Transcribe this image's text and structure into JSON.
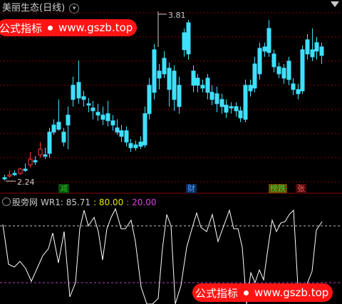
{
  "title": "美丽生态(日线)",
  "banner_top": {
    "label": "公式指标",
    "url": "www.gszb.top"
  },
  "banner_bottom": {
    "label": "公式指标",
    "url": "www.gszb.top"
  },
  "price_high": "3.81",
  "price_low": "2.24",
  "tags": [
    {
      "text": "减",
      "color": "#22c322",
      "bg": "#0a4a0a"
    },
    {
      "text": "财",
      "color": "#4da6ff",
      "bg": "#0a2a55"
    },
    {
      "text": "榜跌",
      "color": "#33dd33",
      "bg": "#6a4a00"
    },
    {
      "text": "张",
      "color": "#ff6060",
      "bg": "#4a0a0a"
    }
  ],
  "indicator": {
    "name": "股旁网",
    "wr_label": "WR1: 85.71",
    "level_high": ": 80.00",
    "level_low": ": 20.00"
  },
  "colors": {
    "up": "#ff3b3b",
    "down": "#3fe0ff",
    "grid": "#8b0000",
    "bg": "#000000"
  },
  "icons": [
    "chevron-down-icon",
    "corner-triangle-icon",
    "settings-circle-icon"
  ]
}
